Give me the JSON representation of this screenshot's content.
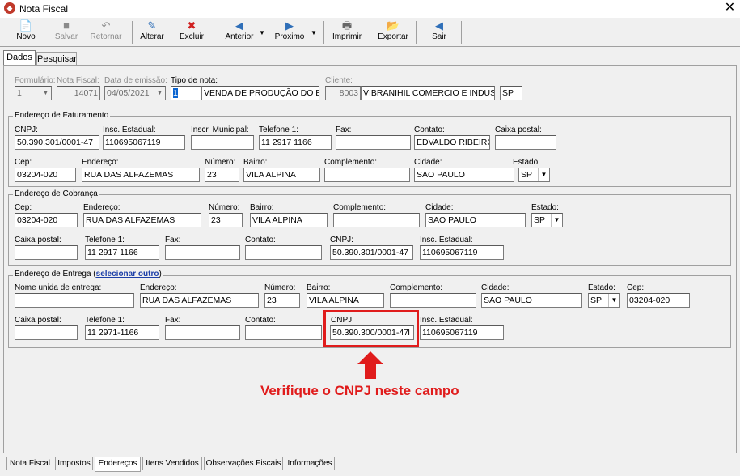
{
  "window": {
    "title": "Nota Fiscal"
  },
  "toolbar": {
    "novo": "Novo",
    "salvar": "Salvar",
    "retornar": "Retornar",
    "alterar": "Alterar",
    "excluir": "Excluir",
    "anterior": "Anterior",
    "proximo": "Proximo",
    "imprimir": "Imprimir",
    "exportar": "Exportar",
    "sair": "Sair"
  },
  "tabs": [
    "Dados",
    "Pesquisar"
  ],
  "header": {
    "formulario_label": "Formulário:",
    "formulario_value": "1",
    "nota_label": "Nota Fiscal:",
    "nota_value": "14071",
    "data_label": "Data de emissão:",
    "data_value": "04/05/2021",
    "tipo_label": "Tipo de nota:",
    "tipo_code": "1",
    "tipo_desc": "VENDA DE PRODUÇÃO DO ES",
    "cliente_label": "Cliente:",
    "cliente_code": "8003",
    "cliente_name": "VIBRANIHIL COMERCIO E INDUSTR",
    "cliente_uf": "SP"
  },
  "faturamento": {
    "title": "Endereço de Faturamento",
    "cnpj_label": "CNPJ:",
    "cnpj": "50.390.301/0001-47",
    "ie_label": "Insc. Estadual:",
    "ie": "110695067119",
    "im_label": "Inscr. Municipal:",
    "im": "",
    "tel_label": "Telefone 1:",
    "tel": "11 2917 1166",
    "fax_label": "Fax:",
    "fax": "",
    "contato_label": "Contato:",
    "contato": "EDVALDO RIBEIRO",
    "cx_label": "Caixa postal:",
    "cx": "",
    "cep_label": "Cep:",
    "cep": "03204-020",
    "end_label": "Endereço:",
    "end": "RUA DAS ALFAZEMAS",
    "num_label": "Número:",
    "num": "23",
    "bairro_label": "Bairro:",
    "bairro": "VILA ALPINA",
    "compl_label": "Complemento:",
    "compl": "",
    "cidade_label": "Cidade:",
    "cidade": "SAO PAULO",
    "estado_label": "Estado:",
    "estado": "SP"
  },
  "cobranca": {
    "title": "Endereço de Cobrança",
    "cep_label": "Cep:",
    "cep": "03204-020",
    "end_label": "Endereço:",
    "end": "RUA DAS ALFAZEMAS",
    "num_label": "Número:",
    "num": "23",
    "bairro_label": "Bairro:",
    "bairro": "VILA ALPINA",
    "compl_label": "Complemento:",
    "compl": "",
    "cidade_label": "Cidade:",
    "cidade": "SAO PAULO",
    "estado_label": "Estado:",
    "estado": "SP",
    "cx_label": "Caixa postal:",
    "cx": "",
    "tel_label": "Telefone 1:",
    "tel": "11 2917 1166",
    "fax_label": "Fax:",
    "fax": "",
    "contato_label": "Contato:",
    "contato": "",
    "cnpj_label": "CNPJ:",
    "cnpj": "50.390.301/0001-47",
    "ie_label": "Insc. Estadual:",
    "ie": "110695067119"
  },
  "entrega": {
    "title": "Endereço de Entrega",
    "link_open": "(",
    "link": "selecionar outro",
    "link_close": ")",
    "nome_label": "Nome unida de entrega:",
    "nome": "",
    "end_label": "Endereço:",
    "end": "RUA DAS ALFAZEMAS",
    "num_label": "Número:",
    "num": "23",
    "bairro_label": "Bairro:",
    "bairro": "VILA ALPINA",
    "compl_label": "Complemento:",
    "compl": "",
    "cidade_label": "Cidade:",
    "cidade": "SAO PAULO",
    "estado_label": "Estado:",
    "estado": "SP",
    "cep_label": "Cep:",
    "cep": "03204-020",
    "cx_label": "Caixa postal:",
    "cx": "",
    "tel_label": "Telefone 1:",
    "tel": "11 2971-1166",
    "fax_label": "Fax:",
    "fax": "",
    "contato_label": "Contato:",
    "contato": "",
    "cnpj_label": "CNPJ:",
    "cnpj": "50.390.300/0001-47",
    "ie_label": "Insc. Estadual:",
    "ie": "110695067119"
  },
  "annotation": {
    "text": "Verifique o CNPJ neste campo",
    "color": "#e01c1c"
  },
  "bottom_tabs": [
    "Nota Fiscal",
    "Impostos",
    "Endereços",
    "Itens Vendidos",
    "Observações Fiscais",
    "Informações"
  ]
}
